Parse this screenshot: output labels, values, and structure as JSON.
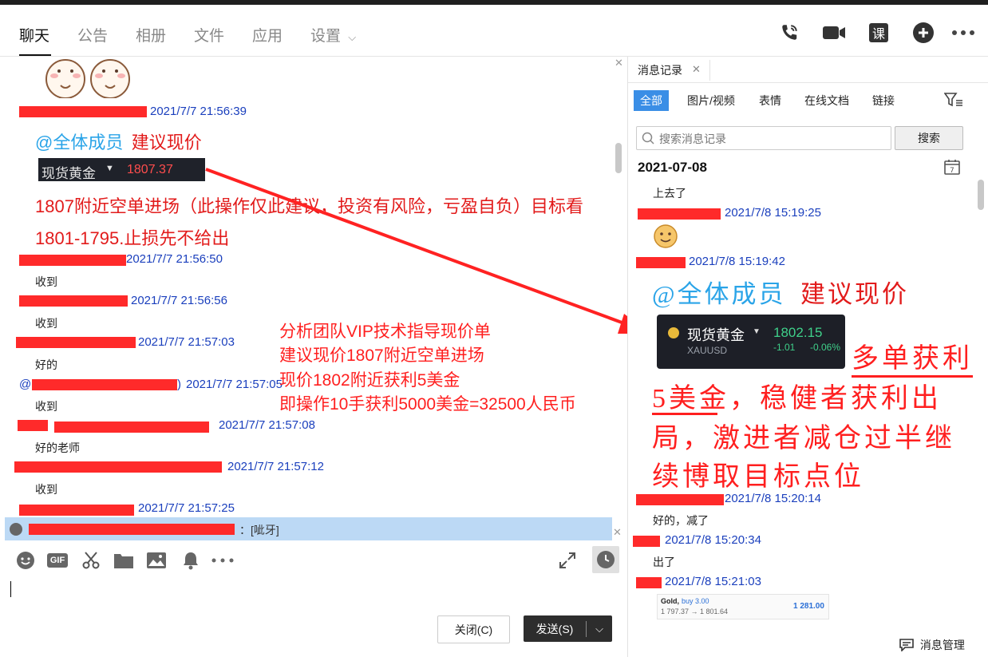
{
  "nav": {
    "tabs": [
      "聊天",
      "公告",
      "相册",
      "文件",
      "应用",
      "设置"
    ],
    "active": "聊天",
    "right_icons": [
      "phone-icon",
      "video-icon",
      "lesson-icon",
      "add-icon",
      "more-icon"
    ],
    "lesson_label": "课"
  },
  "chat": {
    "messages": [
      {
        "time": "2021/7/7 21:56:39"
      },
      {
        "time": "2021/7/7 21:56:50",
        "text": "收到"
      },
      {
        "time": "2021/7/7 21:56:56",
        "text": "收到"
      },
      {
        "time": "2021/7/7 21:57:03",
        "text": "好的"
      },
      {
        "time": "2021/7/7 21:57:05",
        "text": "收到"
      },
      {
        "time": "2021/7/7 21:57:08",
        "text": "好的老师"
      },
      {
        "time": "2021/7/7 21:57:12",
        "text": "收到"
      },
      {
        "time": "2021/7/7 21:57:25"
      }
    ],
    "at_all": "@全体成员",
    "suggest": "建议现价",
    "quote_name": "现货黄金",
    "quote_price": "1807.37",
    "advice_line1": "1807附近空单进场（此操作仅此建议，投资有风险，亏盈自负）目标看",
    "advice_line2": "1801-1795.止损先不给出",
    "annotation": [
      "分析团队VIP技术指导现价单",
      "建议现价1807附近空单进场",
      "现价1802附近获利5美金",
      "即操作10手获利5000美金=32500人民币"
    ],
    "reply_text": "：[呲牙]",
    "extra_prefix": "@",
    "paren_close": ")"
  },
  "toolbar": {
    "icons": [
      "emoji-icon",
      "gif-icon",
      "scissors-icon",
      "folder-icon",
      "image-icon",
      "bell-icon",
      "more-icon"
    ],
    "gif_label": "GIF",
    "close_label": "关闭(C)",
    "send_label": "发送(S)"
  },
  "record": {
    "tab_title": "消息记录",
    "filters": [
      "全部",
      "图片/视频",
      "表情",
      "在线文档",
      "链接"
    ],
    "search_placeholder": "搜索消息记录",
    "search_button": "搜索",
    "date": "2021-07-08",
    "items": [
      {
        "text": "上去了"
      },
      {
        "time": "2021/7/8 15:19:25"
      },
      {
        "time": "2021/7/8 15:19:42"
      },
      {
        "time": "2021/7/8 15:20:14",
        "text": "好的，减了"
      },
      {
        "time": "2021/7/8 15:20:34",
        "text": "出了"
      },
      {
        "time": "2021/7/8 15:21:03"
      }
    ],
    "at_all": "@全体成员",
    "suggest": "建议现价",
    "quote": {
      "name": "现货黄金",
      "symbol": "XAUUSD",
      "price": "1802.15",
      "change": "-1.01",
      "change_pct": "-0.06%"
    },
    "annotation": [
      "多单获利",
      "5美金，稳健者获利出",
      "局，激进者减仓过半继",
      "续博取目标点位"
    ],
    "trade_card": {
      "label": "Gold,",
      "side": "buy 3.00",
      "prices": "1 797.37 → 1 801.64",
      "profit": "1 281.00"
    },
    "footer": "消息管理"
  },
  "colors": {
    "accent": "#3a8ee6",
    "link_blue": "#1a3fbd",
    "red": "#e21b1b",
    "at_blue": "#2aa4e8"
  }
}
